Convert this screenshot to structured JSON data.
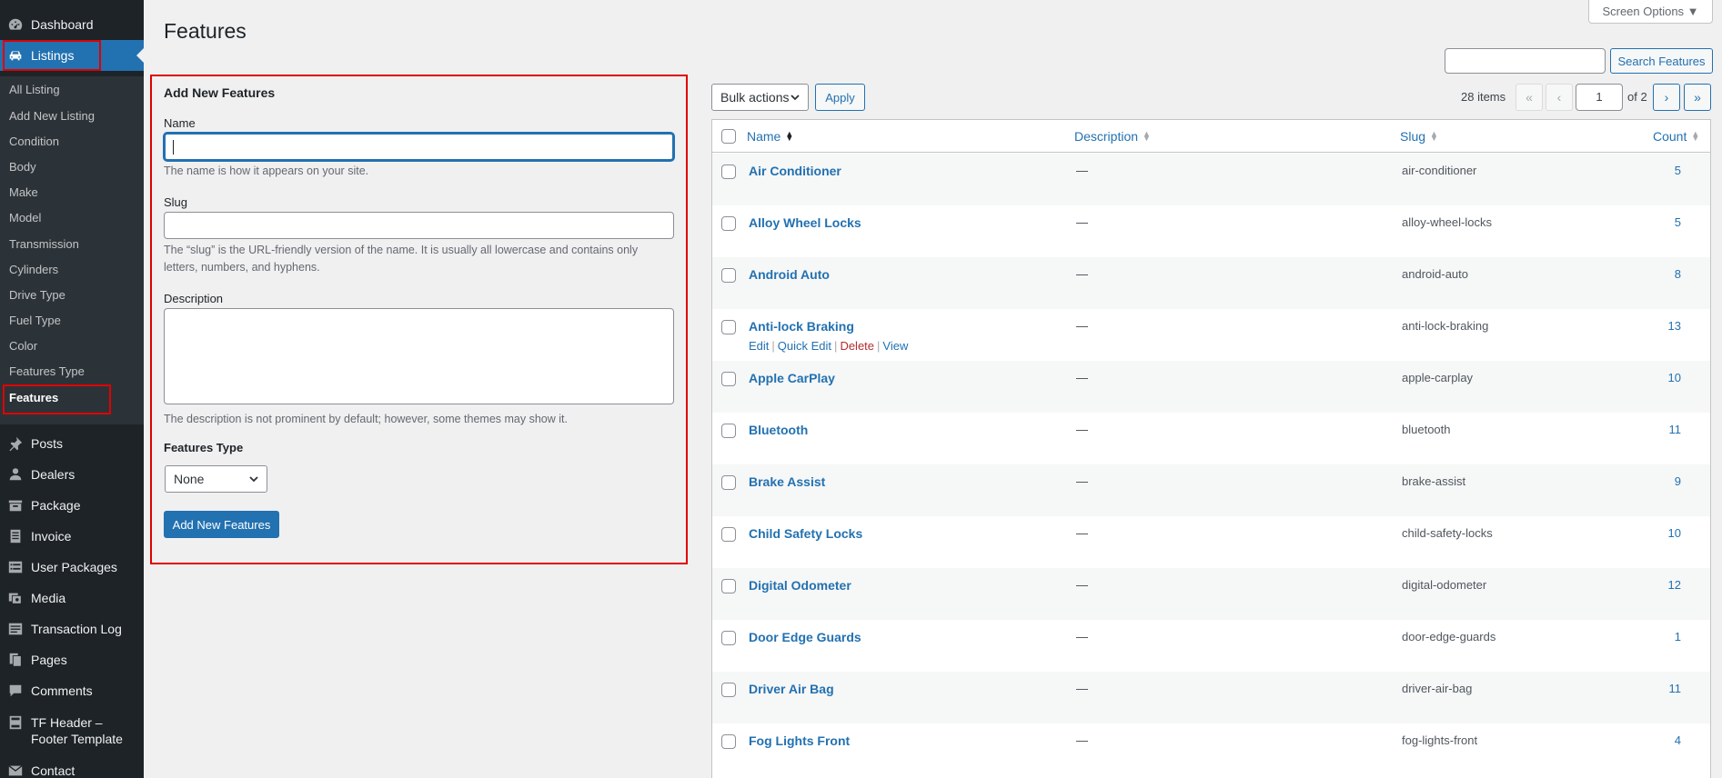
{
  "sidebar": {
    "top_items": [
      {
        "label": "Dashboard",
        "icon": "dashboard-icon"
      },
      {
        "label": "Listings",
        "icon": "car-icon"
      }
    ],
    "submenu": [
      "All Listing",
      "Add New Listing",
      "Condition",
      "Body",
      "Make",
      "Model",
      "Transmission",
      "Cylinders",
      "Drive Type",
      "Fuel Type",
      "Color",
      "Features Type",
      "Features"
    ],
    "bottom_items": [
      {
        "label": "Posts",
        "icon": "pin-icon"
      },
      {
        "label": "Dealers",
        "icon": "user-icon"
      },
      {
        "label": "Package",
        "icon": "package-icon"
      },
      {
        "label": "Invoice",
        "icon": "invoice-icon"
      },
      {
        "label": "User Packages",
        "icon": "list-icon"
      },
      {
        "label": "Media",
        "icon": "media-icon"
      },
      {
        "label": "Transaction Log",
        "icon": "log-icon"
      },
      {
        "label": "Pages",
        "icon": "pages-icon"
      },
      {
        "label": "Comments",
        "icon": "comment-icon"
      },
      {
        "label": "TF Header –",
        "label2": "Footer Template",
        "icon": "template-icon"
      },
      {
        "label": "Contact",
        "icon": "contact-icon"
      }
    ]
  },
  "header": {
    "title": "Features",
    "screen_options": "Screen Options ▼",
    "search_button": "Search Features",
    "search_value": ""
  },
  "form": {
    "heading": "Add New Features",
    "name_label": "Name",
    "name_value": "",
    "name_help": "The name is how it appears on your site.",
    "slug_label": "Slug",
    "slug_value": "",
    "slug_help": "The “slug” is the URL-friendly version of the name. It is usually all lowercase and contains only letters, numbers, and hyphens.",
    "description_label": "Description",
    "description_value": "",
    "description_help": "The description is not prominent by default; however, some themes may show it.",
    "type_label": "Features Type",
    "type_selected": "None",
    "submit_label": "Add New Features"
  },
  "tablenav": {
    "bulk_actions": "Bulk actions",
    "apply": "Apply",
    "items_count": "28 items",
    "first": "«",
    "prev": "‹",
    "current_page": "1",
    "of_pages": "of 2",
    "next": "›",
    "last": "»"
  },
  "table": {
    "columns": {
      "name": "Name",
      "description": "Description",
      "slug": "Slug",
      "count": "Count"
    },
    "rows": [
      {
        "name": "Air Conditioner",
        "description": "—",
        "slug": "air-conditioner",
        "count": "5"
      },
      {
        "name": "Alloy Wheel Locks",
        "description": "—",
        "slug": "alloy-wheel-locks",
        "count": "5"
      },
      {
        "name": "Android Auto",
        "description": "—",
        "slug": "android-auto",
        "count": "8"
      },
      {
        "name": "Anti-lock Braking",
        "description": "—",
        "slug": "anti-lock-braking",
        "count": "13"
      },
      {
        "name": "Apple CarPlay",
        "description": "—",
        "slug": "apple-carplay",
        "count": "10"
      },
      {
        "name": "Bluetooth",
        "description": "—",
        "slug": "bluetooth",
        "count": "11"
      },
      {
        "name": "Brake Assist",
        "description": "—",
        "slug": "brake-assist",
        "count": "9"
      },
      {
        "name": "Child Safety Locks",
        "description": "—",
        "slug": "child-safety-locks",
        "count": "10"
      },
      {
        "name": "Digital Odometer",
        "description": "—",
        "slug": "digital-odometer",
        "count": "12"
      },
      {
        "name": "Door Edge Guards",
        "description": "—",
        "slug": "door-edge-guards",
        "count": "1"
      },
      {
        "name": "Driver Air Bag",
        "description": "—",
        "slug": "driver-air-bag",
        "count": "11"
      },
      {
        "name": "Fog Lights Front",
        "description": "—",
        "slug": "fog-lights-front",
        "count": "4"
      }
    ],
    "row_actions": {
      "edit": "Edit",
      "quick_edit": "Quick Edit",
      "delete": "Delete",
      "view": "View"
    }
  }
}
